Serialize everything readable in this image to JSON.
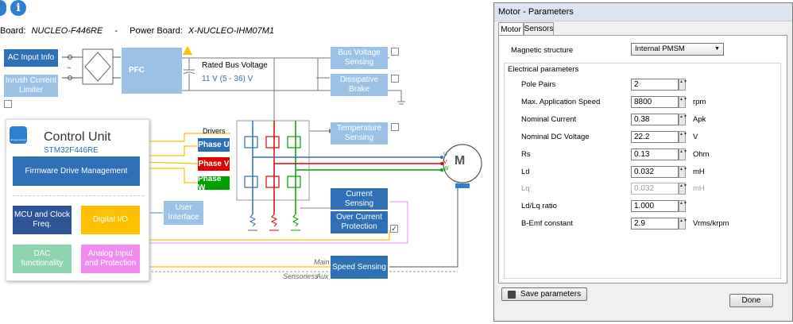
{
  "header": {
    "control_board_label": "Board:",
    "control_board_value": "NUCLEO-F446RE",
    "separator": "-",
    "power_board_label": "Power Board:",
    "power_board_value": "X-NUCLEO-IHM07M1"
  },
  "blocks": {
    "ac_input": "AC Input Info",
    "inrush": "Inrush Current Limiter",
    "pfc": "PFC",
    "rated_bus_voltage_label": "Rated Bus Voltage",
    "rated_bus_voltage_value": "11 V (5 - 36) V",
    "bus_voltage_sensing": "Bus Voltage Sensing",
    "dissipative_brake": "Dissipative Brake",
    "temperature_sensing": "Temperature Sensing",
    "drivers": "Drivers",
    "phase_u": "Phase U",
    "phase_v": "Phase V",
    "phase_w": "Phase W",
    "current_sensing": "Current Sensing",
    "over_current": "Over Current Protection",
    "speed_sensing": "Speed Sensing",
    "user_interface": "User Interface",
    "motor": "M",
    "u": "U",
    "v": "V",
    "w": "W",
    "main": "Main",
    "sensorless": "Sensorless",
    "aux": "Aux"
  },
  "control_unit": {
    "title": "Control Unit",
    "mcu": "STM32F446RE",
    "logo": "life.augmented",
    "firmware": "Firmware Drive Management",
    "mcu_clock": "MCU and Clock Freq.",
    "digital_io": "Digital I/O",
    "dac": "DAC functionality",
    "analog": "Analog Input and Protection"
  },
  "dialog": {
    "title": "Motor - Parameters",
    "tabs": [
      "Motor",
      "Sensors"
    ],
    "magnetic_label": "Magnetic structure",
    "magnetic_value": "Internal PMSM",
    "group_label": "Electrical parameters",
    "params": [
      {
        "label": "Pole Pairs",
        "value": "2",
        "unit": "",
        "disabled": false
      },
      {
        "label": "Max. Application Speed",
        "value": "8800",
        "unit": "rpm",
        "disabled": false
      },
      {
        "label": "Nominal Current",
        "value": "0.38",
        "unit": "Apk",
        "disabled": false
      },
      {
        "label": "Nominal DC Voltage",
        "value": "22.2",
        "unit": "V",
        "disabled": false
      },
      {
        "label": "Rs",
        "value": "0.13",
        "unit": "Ohm",
        "disabled": false
      },
      {
        "label": "Ld",
        "value": "0.032",
        "unit": "mH",
        "disabled": false
      },
      {
        "label": "Lq",
        "value": "0.032",
        "unit": "mH",
        "disabled": true
      },
      {
        "label": "Ld/Lq ratio",
        "value": "1.000",
        "unit": "",
        "disabled": false
      },
      {
        "label": "B-Emf constant",
        "value": "2.9",
        "unit": "Vrms/krpm",
        "disabled": false
      }
    ],
    "save_label": "Save parameters",
    "done_label": "Done"
  },
  "colors": {
    "light_block": "#9cc3e6",
    "dark_block": "#2f6fb5",
    "phase_u": "#2f6fb5",
    "phase_v": "#e00000",
    "phase_w": "#00a000",
    "orange": "#ffc000"
  }
}
